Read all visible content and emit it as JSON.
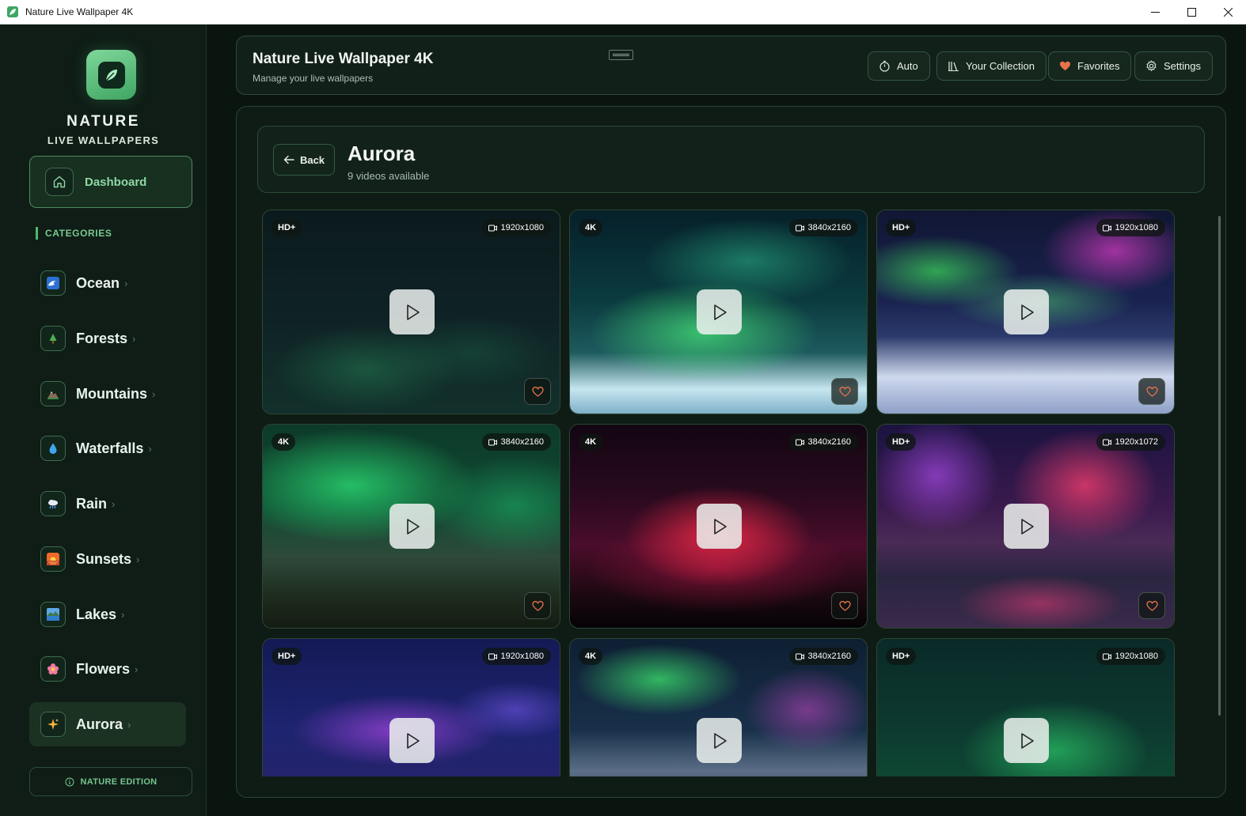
{
  "window": {
    "title": "Nature Live Wallpaper 4K"
  },
  "sidebar": {
    "brand_line1": "NATURE",
    "brand_line2": "LIVE WALLPAPERS",
    "dashboard_label": "Dashboard",
    "categories_heading": "CATEGORIES",
    "categories": [
      {
        "label": "Ocean",
        "icon": "wave-icon"
      },
      {
        "label": "Forests",
        "icon": "tree-icon"
      },
      {
        "label": "Mountains",
        "icon": "mountain-icon"
      },
      {
        "label": "Waterfalls",
        "icon": "droplet-icon"
      },
      {
        "label": "Rain",
        "icon": "rain-cloud-icon"
      },
      {
        "label": "Sunsets",
        "icon": "sunset-icon"
      },
      {
        "label": "Lakes",
        "icon": "lake-icon"
      },
      {
        "label": "Flowers",
        "icon": "flower-icon"
      },
      {
        "label": "Aurora",
        "icon": "sparkle-icon",
        "active": true
      }
    ],
    "edition_label": "NATURE EDITION"
  },
  "header": {
    "title": "Nature Live Wallpaper 4K",
    "subtitle": "Manage your live wallpapers",
    "buttons": {
      "auto": "Auto",
      "collection": "Your Collection",
      "favorites": "Favorites",
      "settings": "Settings"
    }
  },
  "section": {
    "back_label": "Back",
    "title": "Aurora",
    "count_text": "9 videos available"
  },
  "videos": [
    {
      "quality": "HD+",
      "resolution": "1920x1080"
    },
    {
      "quality": "4K",
      "resolution": "3840x2160"
    },
    {
      "quality": "HD+",
      "resolution": "1920x1080"
    },
    {
      "quality": "4K",
      "resolution": "3840x2160"
    },
    {
      "quality": "4K",
      "resolution": "3840x2160"
    },
    {
      "quality": "HD+",
      "resolution": "1920x1072"
    },
    {
      "quality": "HD+",
      "resolution": "1920x1080"
    },
    {
      "quality": "4K",
      "resolution": "3840x2160"
    },
    {
      "quality": "HD+",
      "resolution": "1920x1080"
    }
  ],
  "colors": {
    "accent": "#4fb86e",
    "background": "#0b1510",
    "heart": "#e8734a"
  }
}
